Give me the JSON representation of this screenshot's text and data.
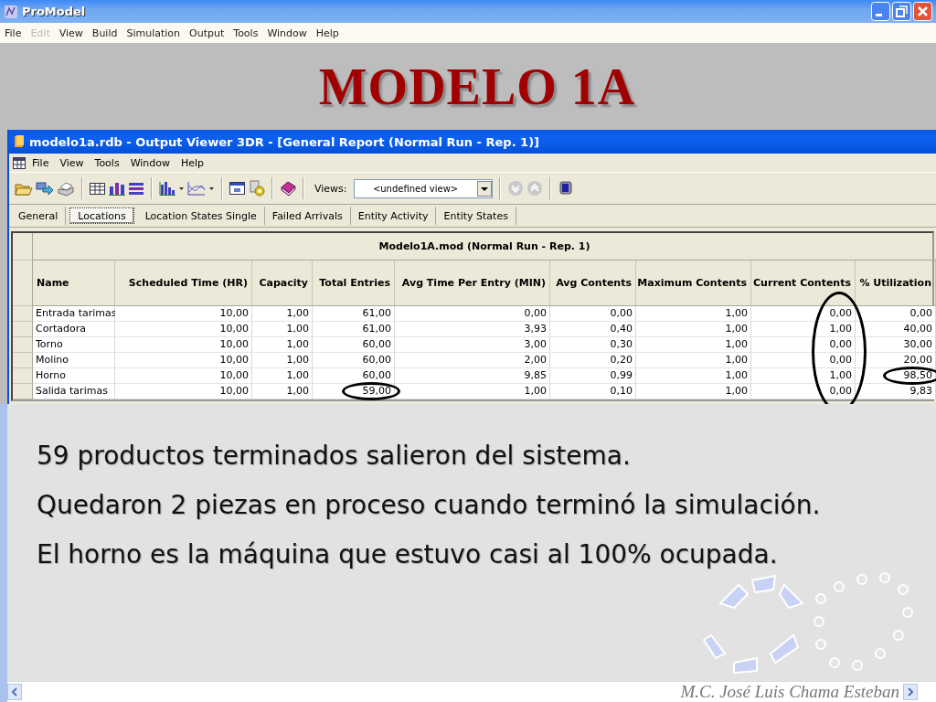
{
  "app": {
    "title": "ProModel",
    "menu": [
      {
        "label": "File",
        "disabled": false
      },
      {
        "label": "Edit",
        "disabled": true
      },
      {
        "label": "View",
        "disabled": false
      },
      {
        "label": "Build",
        "disabled": false
      },
      {
        "label": "Simulation",
        "disabled": false
      },
      {
        "label": "Output",
        "disabled": false
      },
      {
        "label": "Tools",
        "disabled": false
      },
      {
        "label": "Window",
        "disabled": false
      },
      {
        "label": "Help",
        "disabled": false
      }
    ]
  },
  "slide": {
    "title": "MODELO 1A",
    "bullets": [
      "59 productos terminados salieron del sistema.",
      "Quedaron 2 piezas en proceso cuando terminó la simulación.",
      "El horno es la máquina que estuvo casi al 100% ocupada."
    ],
    "author": "M.C. José Luis Chama Esteban"
  },
  "viewer": {
    "title": "modelo1a.rdb - Output Viewer 3DR - [General Report (Normal Run - Rep. 1)]",
    "menu": [
      "File",
      "View",
      "Tools",
      "Window",
      "Help"
    ],
    "views_label": "Views:",
    "views_value": "<undefined view>",
    "tabs": [
      {
        "label": "General",
        "selected": false
      },
      {
        "label": "Locations",
        "selected": true
      },
      {
        "label": "Location States Single",
        "selected": false
      },
      {
        "label": "Failed Arrivals",
        "selected": false
      },
      {
        "label": "Entity Activity",
        "selected": false
      },
      {
        "label": "Entity States",
        "selected": false
      }
    ],
    "report": {
      "heading": "Modelo1A.mod (Normal Run - Rep. 1)",
      "columns": [
        {
          "label": "Name",
          "circled": false
        },
        {
          "label": "Scheduled Time (HR)",
          "circled": false
        },
        {
          "label": "Capacity",
          "circled": false
        },
        {
          "label": "Total Entries",
          "circled": false
        },
        {
          "label": "Avg Time Per Entry (MIN)",
          "circled": false
        },
        {
          "label": "Avg Contents",
          "circled": false
        },
        {
          "label": "Maximum Contents",
          "circled": false
        },
        {
          "label": "Current Contents",
          "circled": true
        },
        {
          "label": "% Utilization",
          "circled": false
        }
      ],
      "rows": [
        {
          "cells": [
            {
              "text": "Entrada tarimas",
              "circled": false
            },
            {
              "text": "10,00",
              "circled": false
            },
            {
              "text": "1,00",
              "circled": false
            },
            {
              "text": "61,00",
              "circled": false
            },
            {
              "text": "0,00",
              "circled": false
            },
            {
              "text": "0,00",
              "circled": false
            },
            {
              "text": "1,00",
              "circled": false
            },
            {
              "text": "0,00",
              "circled": false
            },
            {
              "text": "0,00",
              "circled": false
            }
          ]
        },
        {
          "cells": [
            {
              "text": "Cortadora",
              "circled": false
            },
            {
              "text": "10,00",
              "circled": false
            },
            {
              "text": "1,00",
              "circled": false
            },
            {
              "text": "61,00",
              "circled": false
            },
            {
              "text": "3,93",
              "circled": false
            },
            {
              "text": "0,40",
              "circled": false
            },
            {
              "text": "1,00",
              "circled": false
            },
            {
              "text": "1,00",
              "circled": false
            },
            {
              "text": "40,00",
              "circled": false
            }
          ]
        },
        {
          "cells": [
            {
              "text": "Torno",
              "circled": false
            },
            {
              "text": "10,00",
              "circled": false
            },
            {
              "text": "1,00",
              "circled": false
            },
            {
              "text": "60,00",
              "circled": false
            },
            {
              "text": "3,00",
              "circled": false
            },
            {
              "text": "0,30",
              "circled": false
            },
            {
              "text": "1,00",
              "circled": false
            },
            {
              "text": "0,00",
              "circled": false
            },
            {
              "text": "30,00",
              "circled": false
            }
          ]
        },
        {
          "cells": [
            {
              "text": "Molino",
              "circled": false
            },
            {
              "text": "10,00",
              "circled": false
            },
            {
              "text": "1,00",
              "circled": false
            },
            {
              "text": "60,00",
              "circled": false
            },
            {
              "text": "2,00",
              "circled": false
            },
            {
              "text": "0,20",
              "circled": false
            },
            {
              "text": "1,00",
              "circled": false
            },
            {
              "text": "0,00",
              "circled": false
            },
            {
              "text": "20,00",
              "circled": false
            }
          ]
        },
        {
          "cells": [
            {
              "text": "Horno",
              "circled": false
            },
            {
              "text": "10,00",
              "circled": false
            },
            {
              "text": "1,00",
              "circled": false
            },
            {
              "text": "60,00",
              "circled": false
            },
            {
              "text": "9,85",
              "circled": false
            },
            {
              "text": "0,99",
              "circled": false
            },
            {
              "text": "1,00",
              "circled": false
            },
            {
              "text": "1,00",
              "circled": false
            },
            {
              "text": "98,50",
              "circled": true
            }
          ]
        },
        {
          "cells": [
            {
              "text": "Salida tarimas",
              "circled": false
            },
            {
              "text": "10,00",
              "circled": false
            },
            {
              "text": "1,00",
              "circled": false
            },
            {
              "text": "59,00",
              "circled": true
            },
            {
              "text": "1,00",
              "circled": false
            },
            {
              "text": "0,10",
              "circled": false
            },
            {
              "text": "1,00",
              "circled": false
            },
            {
              "text": "0,00",
              "circled": false
            },
            {
              "text": "9,83",
              "circled": false
            }
          ]
        }
      ]
    }
  }
}
